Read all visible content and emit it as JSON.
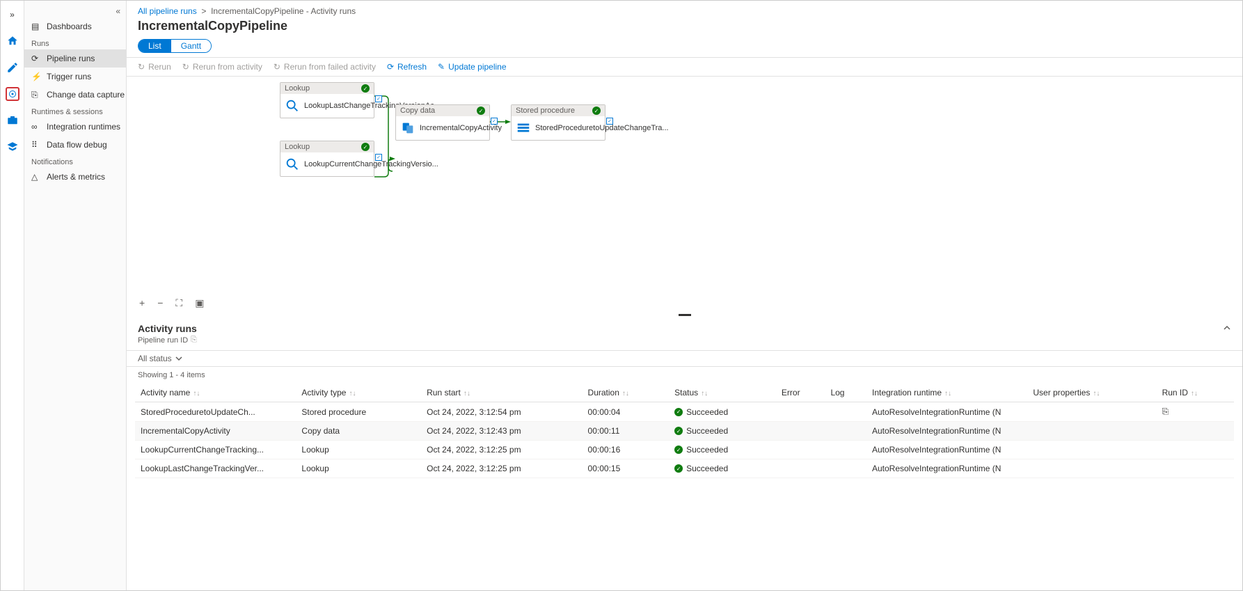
{
  "breadcrumb": {
    "link": "All pipeline runs",
    "current": "IncrementalCopyPipeline - Activity runs"
  },
  "page_title": "IncrementalCopyPipeline",
  "tabs": {
    "list": "List",
    "gantt": "Gantt"
  },
  "toolbar": {
    "rerun": "Rerun",
    "rerun_activity": "Rerun from activity",
    "rerun_failed": "Rerun from failed activity",
    "refresh": "Refresh",
    "update": "Update pipeline"
  },
  "sidebar": {
    "dashboards": "Dashboards",
    "runs": "Runs",
    "pipeline_runs": "Pipeline runs",
    "trigger_runs": "Trigger runs",
    "cdc": "Change data capture (previ...",
    "runtimes": "Runtimes & sessions",
    "integration": "Integration runtimes",
    "dataflow": "Data flow debug",
    "notifications": "Notifications",
    "alerts": "Alerts & metrics"
  },
  "nodes": {
    "lookup1_type": "Lookup",
    "lookup1_name": "LookupLastChangeTrackingVersionAc...",
    "lookup2_type": "Lookup",
    "lookup2_name": "LookupCurrentChangeTrackingVersio...",
    "copy_type": "Copy data",
    "copy_name": "IncrementalCopyActivity",
    "sp_type": "Stored procedure",
    "sp_name": "StoredProceduretoUpdateChangeTra..."
  },
  "activity": {
    "title": "Activity runs",
    "run_id_label": "Pipeline run ID",
    "filter": "All status",
    "showing": "Showing 1 - 4 items"
  },
  "columns": {
    "name": "Activity name",
    "type": "Activity type",
    "start": "Run start",
    "duration": "Duration",
    "status": "Status",
    "error": "Error",
    "log": "Log",
    "runtime": "Integration runtime",
    "userprops": "User properties",
    "runid": "Run ID"
  },
  "rows": [
    {
      "name": "StoredProceduretoUpdateCh...",
      "type": "Stored procedure",
      "start": "Oct 24, 2022, 3:12:54 pm",
      "duration": "00:00:04",
      "status": "Succeeded",
      "runtime": "AutoResolveIntegrationRuntime (N"
    },
    {
      "name": "IncrementalCopyActivity",
      "type": "Copy data",
      "start": "Oct 24, 2022, 3:12:43 pm",
      "duration": "00:00:11",
      "status": "Succeeded",
      "runtime": "AutoResolveIntegrationRuntime (N"
    },
    {
      "name": "LookupCurrentChangeTracking...",
      "type": "Lookup",
      "start": "Oct 24, 2022, 3:12:25 pm",
      "duration": "00:00:16",
      "status": "Succeeded",
      "runtime": "AutoResolveIntegrationRuntime (N"
    },
    {
      "name": "LookupLastChangeTrackingVer...",
      "type": "Lookup",
      "start": "Oct 24, 2022, 3:12:25 pm",
      "duration": "00:00:15",
      "status": "Succeeded",
      "runtime": "AutoResolveIntegrationRuntime (N"
    }
  ]
}
